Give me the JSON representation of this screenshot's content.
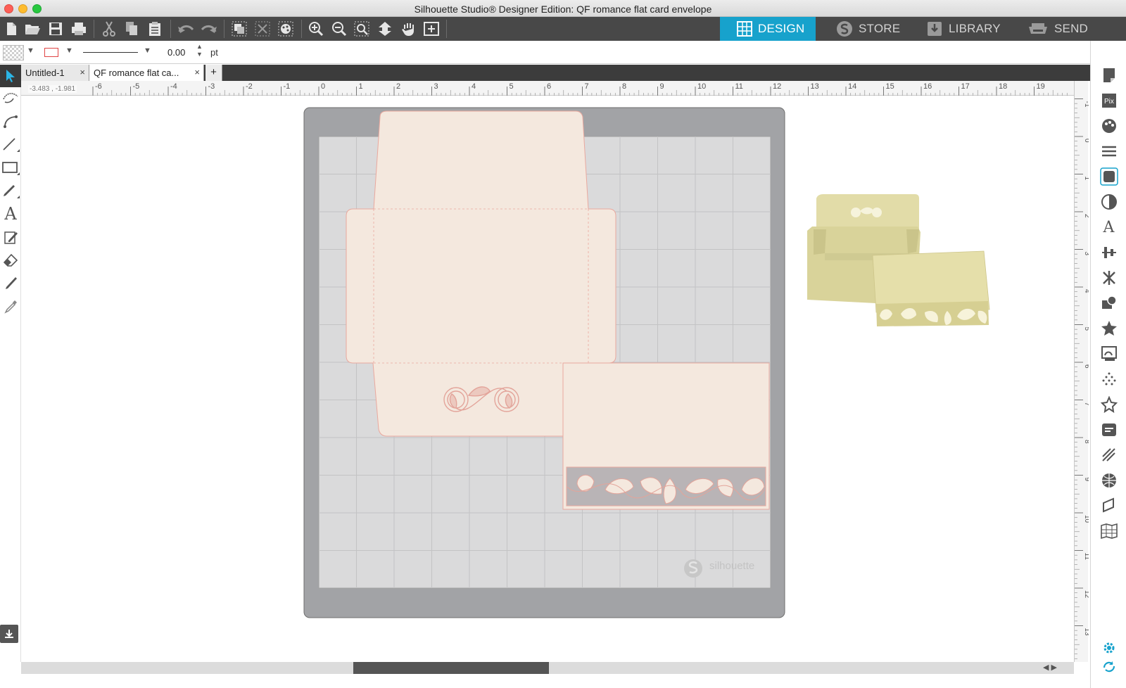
{
  "window": {
    "title": "Silhouette Studio® Designer Edition: QF romance flat card envelope"
  },
  "toolbar": {
    "icons": [
      "new-icon",
      "open-icon",
      "save-icon",
      "print-icon",
      "cut-icon",
      "copy-icon",
      "paste-icon",
      "undo-icon",
      "redo-icon",
      "group-icon",
      "ungroup-icon",
      "select-all-icon",
      "zoom-in-icon",
      "zoom-out-icon",
      "zoom-fit-icon",
      "move-down-icon",
      "pan-hand-icon",
      "fit-to-page-icon"
    ],
    "tabs": [
      {
        "label": "DESIGN",
        "icon": "grid-icon",
        "active": true
      },
      {
        "label": "STORE",
        "icon": "silhouette-s-icon",
        "active": false
      },
      {
        "label": "LIBRARY",
        "icon": "library-download-icon",
        "active": false
      },
      {
        "label": "SEND",
        "icon": "send-printer-icon",
        "active": false
      }
    ],
    "accent_color": "#17a2cc"
  },
  "properties": {
    "line_width_value": "0.00",
    "line_width_unit": "pt"
  },
  "doc_tabs": [
    {
      "label": "Untitled-1"
    },
    {
      "label": "QF romance flat ca..."
    }
  ],
  "ruler": {
    "cursor_x": "-3.483",
    "cursor_y": "-1.981",
    "h_labels": [
      "-6",
      "-5",
      "-4",
      "-3",
      "-2",
      "-1",
      "0",
      "1",
      "2",
      "3",
      "4",
      "5",
      "6",
      "7",
      "8",
      "9",
      "10",
      "11",
      "12",
      "13",
      "14",
      "15",
      "16",
      "17",
      "18",
      "19"
    ],
    "v_labels": [
      "-1",
      "0",
      "1",
      "2",
      "3",
      "4",
      "5",
      "6",
      "7",
      "8",
      "9",
      "10",
      "11",
      "12",
      "13"
    ]
  },
  "mat": {
    "watermark": "silhouette",
    "shape_color": "#f4e8de",
    "shape_stroke": "#e9a89e",
    "mat_color": "#a2a3a6",
    "grid_color": "#d9d9d9"
  },
  "preview_image": {
    "card_color": "#e3dda8"
  }
}
